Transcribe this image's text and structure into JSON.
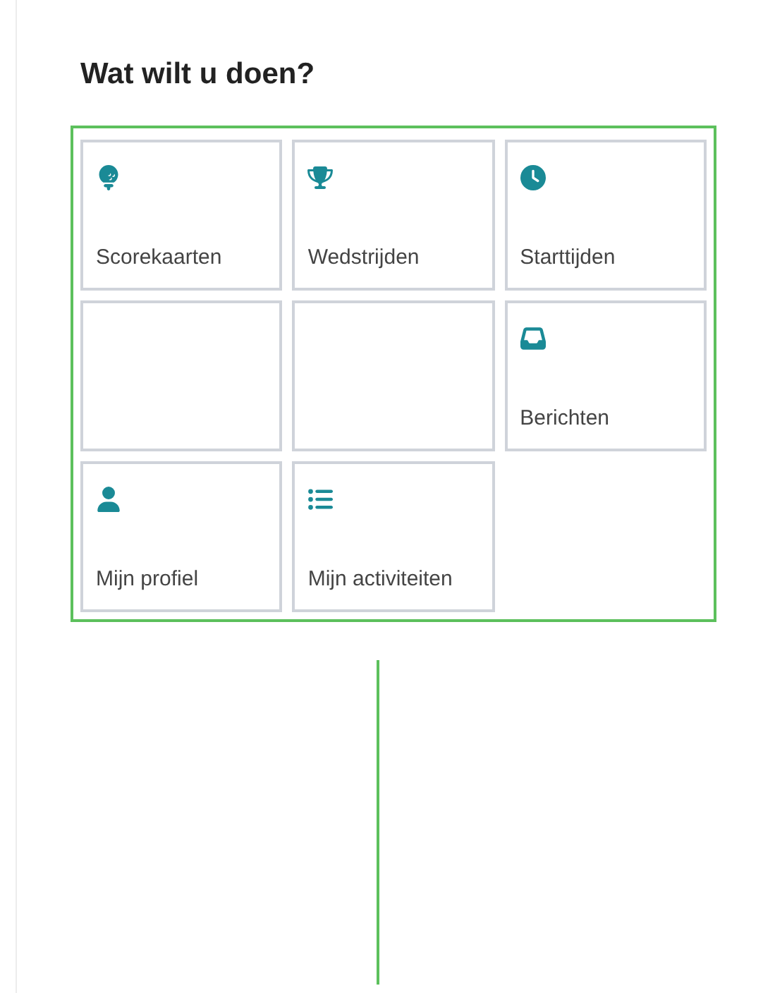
{
  "heading": "Wat wilt u doen?",
  "tiles": [
    {
      "kind": "golf",
      "label": "Scorekaarten"
    },
    {
      "kind": "trophy",
      "label": "Wedstrijden"
    },
    {
      "kind": "clock",
      "label": "Starttijden"
    },
    {
      "kind": "blank"
    },
    {
      "kind": "blank"
    },
    {
      "kind": "inbox",
      "label": "Berichten"
    },
    {
      "kind": "user",
      "label": "Mijn profiel"
    },
    {
      "kind": "list",
      "label": "Mijn activiteiten"
    }
  ]
}
